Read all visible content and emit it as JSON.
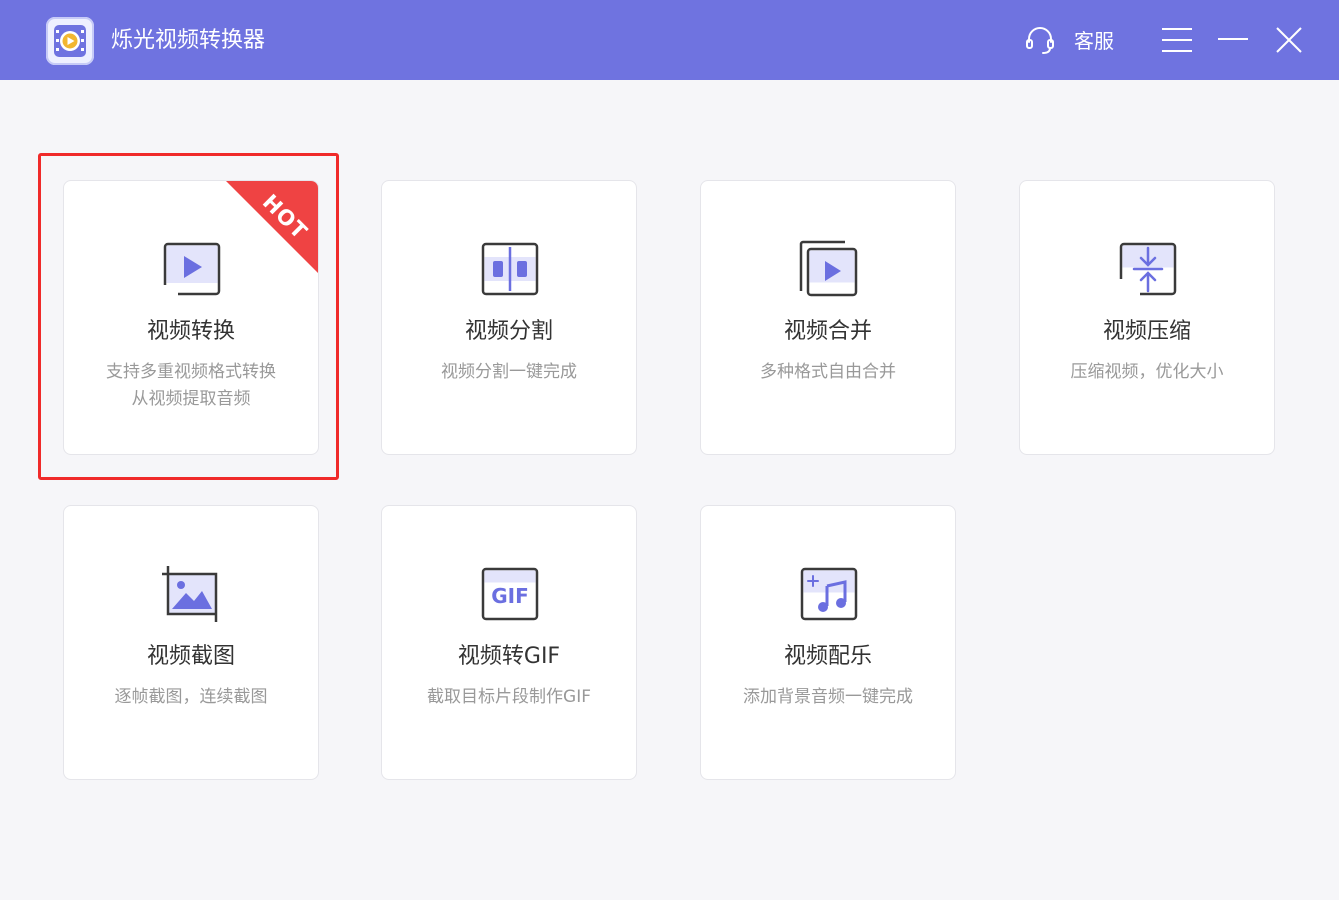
{
  "titlebar": {
    "app_name": "烁光视频转换器",
    "support_label": "客服",
    "bg_color": "#6f73e0"
  },
  "cards": [
    {
      "title": "视频转换",
      "desc": [
        "支持多重视频格式转换",
        "从视频提取音频"
      ],
      "icon": "video-convert-icon",
      "badge": "HOT",
      "highlighted": true
    },
    {
      "title": "视频分割",
      "desc": [
        "视频分割一键完成"
      ],
      "icon": "video-split-icon"
    },
    {
      "title": "视频合并",
      "desc": [
        "多种格式自由合并"
      ],
      "icon": "video-merge-icon"
    },
    {
      "title": "视频压缩",
      "desc": [
        "压缩视频，优化大小"
      ],
      "icon": "video-compress-icon"
    },
    {
      "title": "视频截图",
      "desc": [
        "逐帧截图，连续截图"
      ],
      "icon": "video-screenshot-icon"
    },
    {
      "title": "视频转GIF",
      "desc": [
        "截取目标片段制作GIF"
      ],
      "icon": "video-to-gif-icon",
      "icon_text": "GIF"
    },
    {
      "title": "视频配乐",
      "desc": [
        "添加背景音频一键完成"
      ],
      "icon": "video-music-icon"
    }
  ],
  "colors": {
    "accent": "#6f73e0",
    "icon_fill": "#6b6fe0",
    "icon_light": "#e3e4fb",
    "icon_stroke": "#3a3a3a",
    "hot_red": "#ef4343",
    "highlight_red": "#f02a2a"
  }
}
